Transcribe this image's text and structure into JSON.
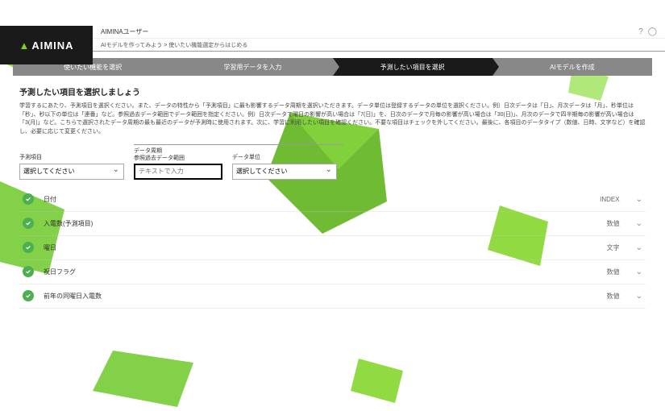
{
  "logo": {
    "text": "AIMINA"
  },
  "user": {
    "name": "AIMINAユーザー"
  },
  "breadcrumb": "AIモデルを作ってみよう > 使いたい機能選定からはじめる",
  "steps": [
    "使いたい機能を選択",
    "学習用データを入力",
    "予測したい項目を選択",
    "AIモデルを作成"
  ],
  "section": {
    "title": "予測したい項目を選択しましょう",
    "desc": "学習するにあたり、予測項目を選択ください。また、データの特性から「予測項目」に最も影響するデータ周期を選択いただきます。データ単位は登録するデータの単位を選択ください。例）日次データは「日」、月次データは「月」、秒単位は「秒」、秒以下の単位は「連番」など。参照過去データ範囲でデータ範囲を指定ください。例）日次データで曜日の影響が高い場合は「7(日)」を、日次のデータで月毎の影響が高い場合は「30(日)」、月次のデータで四半期毎の影響が高い場合は「3(月)」など。こちらで選択されたデータ周期の最も最近のデータが予測時に使用されます。次に、学習に利用したい項目を確認ください。不要な項目はチェックを外してください。最後に、各項目のデータタイプ（数値、日時、文字など）を確認し、必要に応じて変更ください。"
  },
  "form": {
    "predict_label": "予測項目",
    "predict_placeholder": "選択してください",
    "period_fieldset": "データ周期",
    "range_label": "参照過去データ範囲",
    "range_placeholder": "テキストで入力",
    "unit_label": "データ単位",
    "unit_placeholder": "選択してください"
  },
  "items": [
    {
      "name": "日付",
      "type": "INDEX"
    },
    {
      "name": "入電数(予測項目)",
      "type": "数値"
    },
    {
      "name": "曜日",
      "type": "文字"
    },
    {
      "name": "祝日フラグ",
      "type": "数値"
    },
    {
      "name": "前年の同曜日入電数",
      "type": "数値"
    }
  ],
  "icons": {
    "help": "?",
    "user": "◯"
  }
}
